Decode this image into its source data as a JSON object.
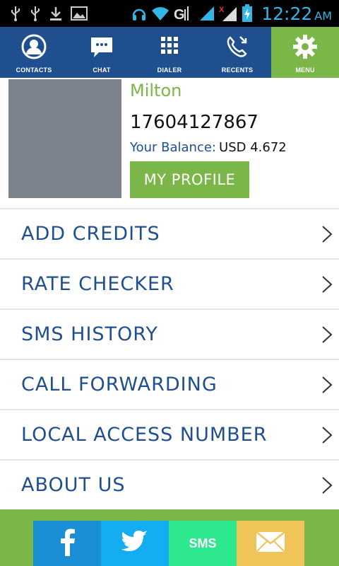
{
  "status_bar": {
    "time": "12:22",
    "ampm": "AM",
    "left_icons": [
      "usb-icon",
      "usb-icon",
      "download-icon",
      "image-icon"
    ],
    "right_icons": [
      "headphones-icon",
      "wifi-icon",
      "gprs-icon",
      "signal-icon",
      "no-signal-icon",
      "battery-charging-icon"
    ]
  },
  "nav": {
    "items": [
      {
        "label": "CONTACTS",
        "icon": "contacts-icon"
      },
      {
        "label": "CHAT",
        "icon": "chat-icon"
      },
      {
        "label": "DIALER",
        "icon": "dialer-icon"
      },
      {
        "label": "RECENTS",
        "icon": "recents-icon"
      },
      {
        "label": "MENU",
        "icon": "gear-icon",
        "active": true
      }
    ]
  },
  "profile": {
    "name": "Milton",
    "phone": "17604127867",
    "balance_label": "Your Balance:",
    "balance_value": "USD 4.672",
    "button_label": "MY PROFILE"
  },
  "menu": {
    "items": [
      {
        "label": "ADD CREDITS"
      },
      {
        "label": "RATE CHECKER"
      },
      {
        "label": "SMS HISTORY"
      },
      {
        "label": "CALL FORWARDING"
      },
      {
        "label": "LOCAL ACCESS NUMBER"
      },
      {
        "label": "ABOUT US"
      }
    ]
  },
  "footer": {
    "buttons": [
      {
        "name": "facebook",
        "color": "#1b8fd6"
      },
      {
        "name": "twitter",
        "color": "#14aef0"
      },
      {
        "name": "sms",
        "label": "SMS",
        "color": "#2ee890"
      },
      {
        "name": "email",
        "color": "#efc55a"
      }
    ]
  },
  "colors": {
    "accent_green": "#7ab648",
    "nav_blue": "#1f4f8f",
    "status_blue": "#33b5e5"
  }
}
